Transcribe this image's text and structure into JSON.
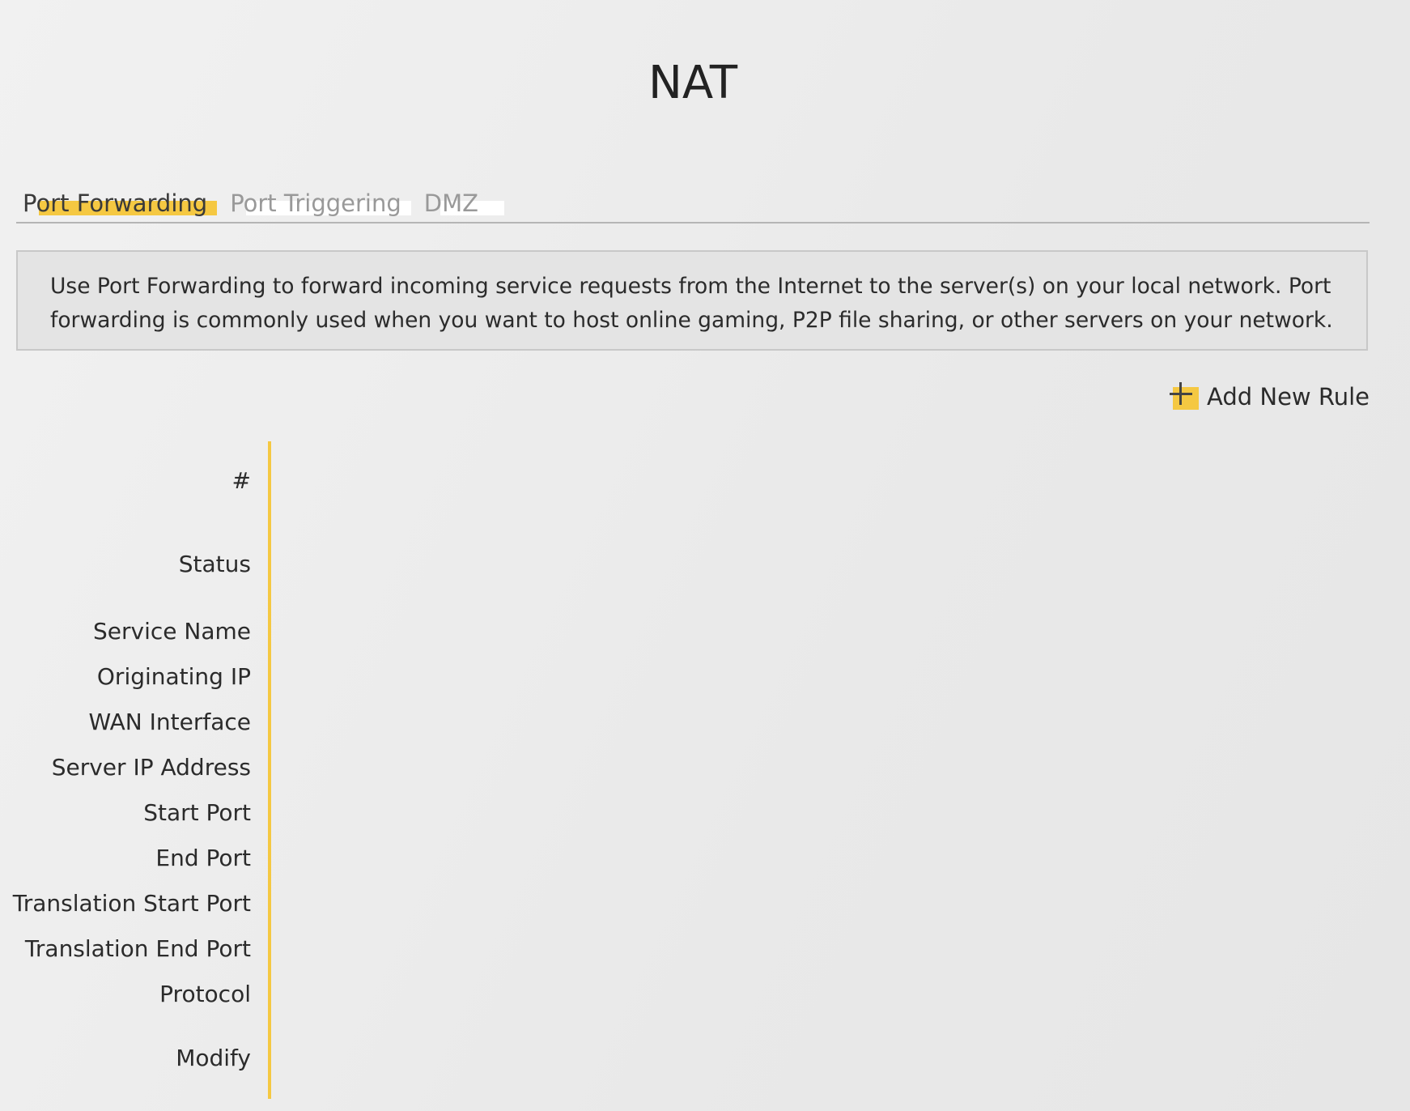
{
  "page_title": "NAT",
  "tabs": [
    {
      "label": "Port Forwarding",
      "active": true
    },
    {
      "label": "Port Triggering",
      "active": false
    },
    {
      "label": "DMZ",
      "active": false
    }
  ],
  "description": "Use Port Forwarding to forward incoming service requests from the Internet to the server(s) on your local network. Port forwarding is commonly used when you want to host online gaming, P2P file sharing, or other servers on your network.",
  "add_rule_label": "Add New Rule",
  "table_headers": [
    "#",
    "Status",
    "Service Name",
    "Originating IP",
    "WAN Interface",
    "Server IP Address",
    "Start Port",
    "End Port",
    "Translation Start Port",
    "Translation End Port",
    "Protocol",
    "Modify"
  ],
  "colors": {
    "accent": "#f5c842"
  }
}
